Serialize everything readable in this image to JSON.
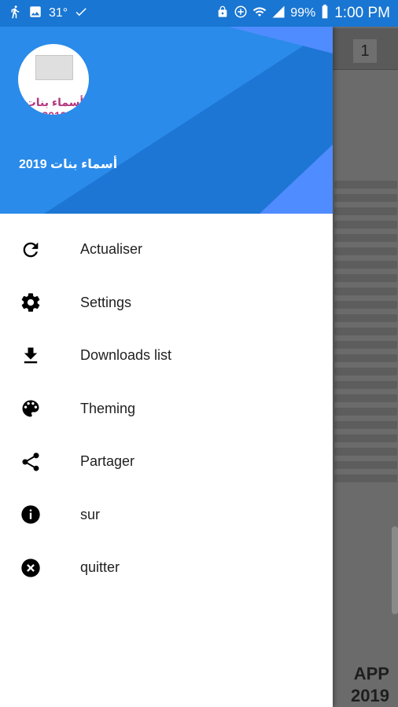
{
  "status_bar": {
    "temperature": "31°",
    "battery_percent": "99%",
    "time": "1:00 PM"
  },
  "drawer": {
    "header": {
      "avatar_text": "أسماء بنات 2019",
      "title": "أسماء بنات 2019",
      "colors": {
        "primary": "#2a8bea",
        "secondary": "#1e76d4",
        "accent": "#4f8cff"
      }
    },
    "menu": [
      {
        "label": "Actualiser",
        "icon": "refresh-icon"
      },
      {
        "label": "Settings",
        "icon": "gear-icon"
      },
      {
        "label": "Downloads list",
        "icon": "download-icon"
      },
      {
        "label": "Theming",
        "icon": "palette-icon"
      },
      {
        "label": "Partager",
        "icon": "share-icon"
      },
      {
        "label": "sur",
        "icon": "info-icon"
      },
      {
        "label": "quitter",
        "icon": "close-circle-icon"
      }
    ]
  },
  "background_app": {
    "page_number": "1",
    "app_label": "APP\n2019"
  }
}
